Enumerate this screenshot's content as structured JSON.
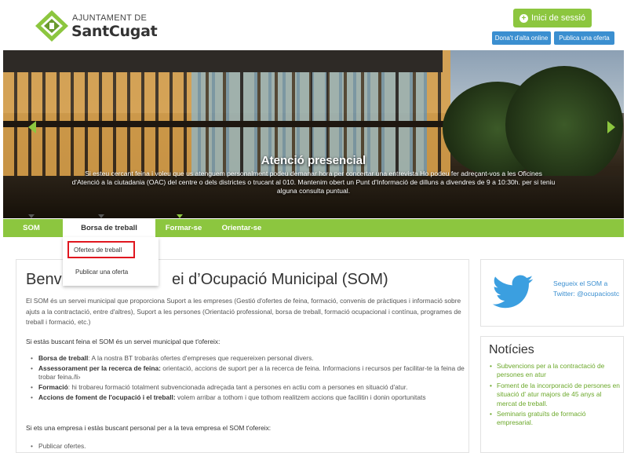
{
  "colors": {
    "accent_green": "#8cc63f",
    "button_blue": "#3b8fd0",
    "highlight_red": "#e0161f",
    "link_green": "#6ba82a"
  },
  "header": {
    "logo_line1": "AJUNTAMENT DE",
    "logo_line2": "SantCugat",
    "logo_icon": "sant-cugat-diamond-logo",
    "login_label": "Inici de sessió",
    "login_icon": "plus-circle-icon",
    "register_label": "Dona't d'alta online",
    "publish_label": "Publica una oferta"
  },
  "banner": {
    "title": "Atenció presencial",
    "text": "Si esteu cercant feina i voleu que us atenguem personalment podeu demanar hora per concertar una entrevista Ho podeu fer adreçant-vos a les Oficines d'Atenció a la ciutadania (OAC) del centre o dels districtes o trucant al 010. Mantenim obert un Punt d'Informació de dilluns a divendres de 9 a 10:30h. per si teniu alguna consulta puntual."
  },
  "nav": {
    "items": [
      {
        "label": "SOM"
      },
      {
        "label": "Borsa de treball"
      },
      {
        "label": "Formar-se"
      },
      {
        "label": "Orientar-se"
      }
    ],
    "active_index": 1,
    "dropdown": [
      "Ofertes de treball",
      "Publicar una oferta"
    ]
  },
  "main": {
    "title": "Benvi                 ei d’Ocupació Municipal (SOM)",
    "title_visible_start": "Benvi",
    "title_visible_end": "ei d’Ocupació Municipal (SOM)",
    "intro": "El SOM és un servei municipal que proporciona Suport a les empreses (Gestió d'ofertes de feina, formació, convenis de pràctiques i informació sobre ajuts a la contractació, entre d'altres), Suport a les persones (Orientació professional, borsa de treball, formació ocupacional i contínua, programes de treball i formació, etc.)",
    "section1": "Si estàs buscant feina el SOM és un servei municipal que t'ofereix:",
    "bullets1": [
      {
        "bold": "Borsa de treball",
        "text": ": A la nostra BT trobaràs ofertes d'empreses que requereixen personal divers."
      },
      {
        "bold": "Assessorament per la recerca de feina:",
        "text": " orientació, accions de suport per a la recerca de feina. Informacions i recursos per facilitar-te la feina de trobar feina./li›"
      },
      {
        "bold": "Formació",
        "text": ": hi trobareu formació totalment subvencionada adreçada tant a persones en actiu com a persones en situació d'atur."
      },
      {
        "bold": "Accions de foment de l'ocupació i el treball:",
        "text": " volem arribar a tothom i que tothom realitzem accions que facilitin i donin oportunitats"
      }
    ],
    "section2": "Si ets una empresa i estàs buscant personal per a la teva empresa el SOM t'ofereix:",
    "bullets2": [
      "Publicar ofertes."
    ]
  },
  "sidebar": {
    "twitter_icon": "twitter-bird-icon",
    "twitter_text": "Segueix el SOM a Twitter: @ocupaciostc",
    "news_title": "Notícies",
    "news": [
      "Subvencions per a la contractació de persones en atur",
      "Foment de la incorporació de persones en situació d' atur majors de 45 anys al mercat de treball.",
      "Seminaris gratuïts de formació empresarial."
    ]
  }
}
